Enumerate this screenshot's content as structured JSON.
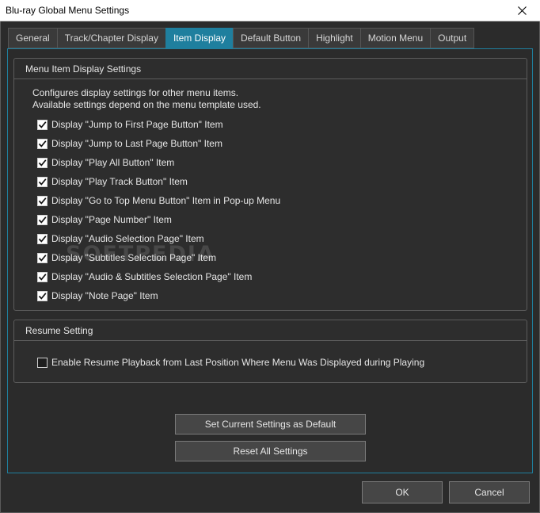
{
  "window": {
    "title": "Blu-ray Global Menu Settings"
  },
  "tabs": [
    {
      "label": "General",
      "active": false
    },
    {
      "label": "Track/Chapter Display",
      "active": false
    },
    {
      "label": "Item Display",
      "active": true
    },
    {
      "label": "Default Button",
      "active": false
    },
    {
      "label": "Highlight",
      "active": false
    },
    {
      "label": "Motion Menu",
      "active": false
    },
    {
      "label": "Output",
      "active": false
    }
  ],
  "menu_item_group": {
    "title": "Menu Item Display Settings",
    "description_line1": "Configures display settings for other menu items.",
    "description_line2": "Available settings depend on the menu template used.",
    "items": [
      {
        "label": "Display \"Jump to First Page Button\" Item",
        "checked": true
      },
      {
        "label": "Display \"Jump to Last Page Button\" Item",
        "checked": true
      },
      {
        "label": "Display \"Play All Button\" Item",
        "checked": true
      },
      {
        "label": "Display \"Play Track Button\" Item",
        "checked": true
      },
      {
        "label": "Display \"Go to Top Menu Button\" Item in Pop-up Menu",
        "checked": true
      },
      {
        "label": "Display \"Page Number\" Item",
        "checked": true
      },
      {
        "label": "Display \"Audio Selection Page\" Item",
        "checked": true
      },
      {
        "label": "Display \"Subtitles Selection Page\" Item",
        "checked": true
      },
      {
        "label": "Display \"Audio & Subtitles Selection Page\" Item",
        "checked": true
      },
      {
        "label": "Display \"Note Page\" Item",
        "checked": true
      }
    ]
  },
  "resume_group": {
    "title": "Resume Setting",
    "item": {
      "label": "Enable Resume Playback from Last Position Where Menu Was Displayed during Playing",
      "checked": false
    }
  },
  "buttons": {
    "set_default": "Set Current Settings as Default",
    "reset_all": "Reset All Settings",
    "ok": "OK",
    "cancel": "Cancel"
  },
  "watermark": "SOFTPEDIA"
}
